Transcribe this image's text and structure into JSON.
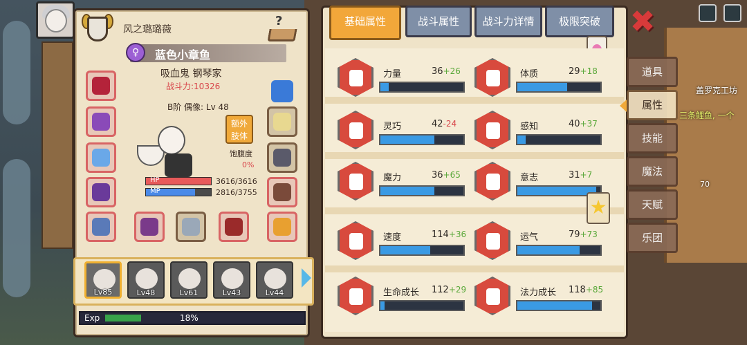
{
  "player": {
    "name": "风之璐璐薇"
  },
  "character": {
    "title": "蓝色小章鱼",
    "class": "吸血鬼 钢琴家",
    "power": "战斗力:10326",
    "rank": "B阶 偶像: Lv 48",
    "extra_limb_button": "额外\n肢体",
    "satiety_label": "饱腹度",
    "satiety_value": "0%",
    "hp": {
      "label": "HP",
      "value": "3616/3616",
      "fraction": 1.0
    },
    "mp": {
      "label": "MP",
      "value": "2816/3755",
      "fraction": 0.75
    }
  },
  "companions": [
    {
      "level": "Lv85",
      "selected": true
    },
    {
      "level": "Lv48",
      "selected": false
    },
    {
      "level": "Lv61",
      "selected": false
    },
    {
      "level": "Lv43",
      "selected": false
    },
    {
      "level": "Lv44",
      "selected": false
    }
  ],
  "exp": {
    "label": "Exp",
    "percent_text": "18%",
    "fraction": 0.18
  },
  "tabs": [
    {
      "label": "基础属性",
      "active": true
    },
    {
      "label": "战斗属性",
      "active": false
    },
    {
      "label": "战斗力详情",
      "active": false
    },
    {
      "label": "极限突破",
      "active": false
    }
  ],
  "stats": [
    {
      "name": "力量",
      "base": "36",
      "bonus": "+26",
      "bonus_color": "#5aa83a",
      "fill": 0.1,
      "icon": "arm-icon"
    },
    {
      "name": "体质",
      "base": "29",
      "bonus": "+18",
      "bonus_color": "#5aa83a",
      "fill": 0.6,
      "icon": "torso-icon"
    },
    {
      "name": "灵巧",
      "base": "42",
      "bonus": "-24",
      "bonus_color": "#d8454a",
      "fill": 0.65,
      "icon": "runner-icon"
    },
    {
      "name": "感知",
      "base": "40",
      "bonus": "+37",
      "bonus_color": "#5aa83a",
      "fill": 0.1,
      "icon": "eye-icon"
    },
    {
      "name": "魔力",
      "base": "36",
      "bonus": "+65",
      "bonus_color": "#5aa83a",
      "fill": 0.65,
      "icon": "swirl-icon"
    },
    {
      "name": "意志",
      "base": "31",
      "bonus": "+7",
      "bonus_color": "#5aa83a",
      "fill": 0.95,
      "icon": "head-icon"
    },
    {
      "name": "速度",
      "base": "114",
      "bonus": "+36",
      "bonus_color": "#5aa83a",
      "fill": 0.6,
      "icon": "wing-icon"
    },
    {
      "name": "运气",
      "base": "79",
      "bonus": "+73",
      "bonus_color": "#5aa83a",
      "fill": 0.75,
      "icon": "clover-icon"
    },
    {
      "name": "生命成长",
      "base": "112",
      "bonus": "+29",
      "bonus_color": "#5aa83a",
      "fill": 0.05,
      "icon": "heart-icon"
    },
    {
      "name": "法力成长",
      "base": "118",
      "bonus": "+85",
      "bonus_color": "#5aa83a",
      "fill": 0.9,
      "icon": "magic-star-icon"
    }
  ],
  "side_menu": [
    {
      "label": "道具",
      "active": false
    },
    {
      "label": "属性",
      "active": true
    },
    {
      "label": "技能",
      "active": false
    },
    {
      "label": "魔法",
      "active": false
    },
    {
      "label": "天赋",
      "active": false
    },
    {
      "label": "乐团",
      "active": false
    }
  ],
  "scene": {
    "shop_label": "盖罗克工坊",
    "fish_label": "三条鲤鱼, 一个",
    "ore_count": "70"
  },
  "colors": {
    "accent_orange": "#f2a73a",
    "stat_bar_blue": "#3a9ae4",
    "power_red": "#d8454a",
    "bonus_green": "#5aa83a"
  }
}
